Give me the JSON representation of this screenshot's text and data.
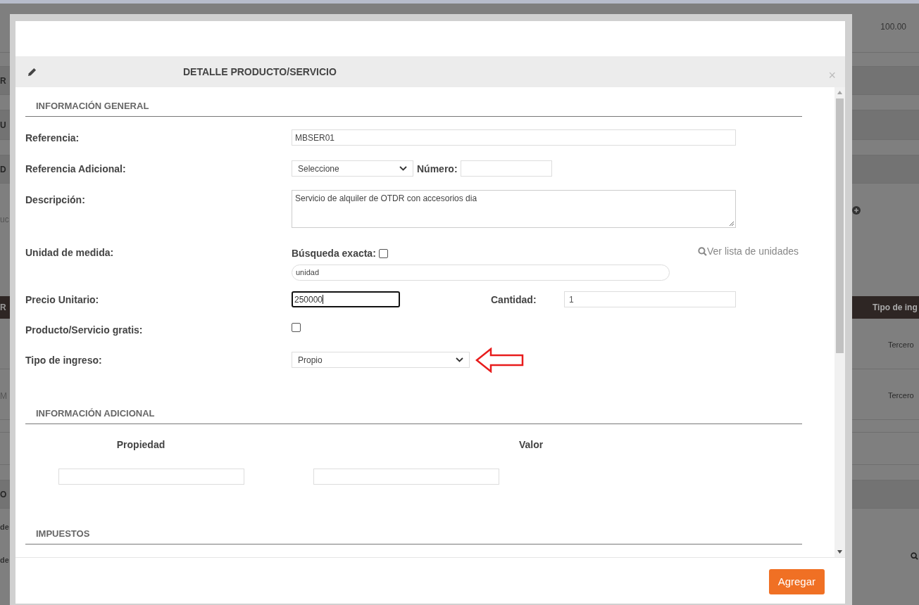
{
  "background": {
    "top_row": [
      "100.00"
    ],
    "left_fragments": [
      "R",
      "U",
      "D",
      "uc",
      "R",
      "M",
      "O",
      "de",
      "de"
    ],
    "header_right": "Tipo de ing",
    "rows_right": [
      "Tercero",
      "Tercero"
    ]
  },
  "dialog": {
    "title": "DETALLE PRODUCTO/SERVICIO",
    "close": "×",
    "general": {
      "title": "INFORMACIÓN GENERAL",
      "referencia": {
        "label": "Referencia:",
        "value": "MBSER01"
      },
      "referencia_adicional": {
        "label": "Referencia Adicional:",
        "select": "Seleccione",
        "numero_label": "Número:"
      },
      "descripcion": {
        "label": "Descripción:",
        "value": "Servicio de alquiler de OTDR con accesorios dia"
      },
      "unidad": {
        "label": "Unidad de medida:",
        "exact_label": "Búsqueda exacta:",
        "exact_checked": false,
        "link": "Ver lista de unidades",
        "value": "unidad"
      },
      "precio": {
        "label": "Precio Unitario:",
        "value": "250000",
        "focused": true
      },
      "cantidad": {
        "label": "Cantidad:",
        "value": "1"
      },
      "gratis": {
        "label": "Producto/Servicio gratis:",
        "checked": false
      },
      "tipo_ingreso": {
        "label": "Tipo de ingreso:",
        "value": "Propio"
      }
    },
    "adicional": {
      "title": "INFORMACIÓN ADICIONAL",
      "columns": [
        "Propiedad",
        "Valor"
      ]
    },
    "impuestos": {
      "title": "IMPUESTOS"
    },
    "button": "Agregar"
  }
}
